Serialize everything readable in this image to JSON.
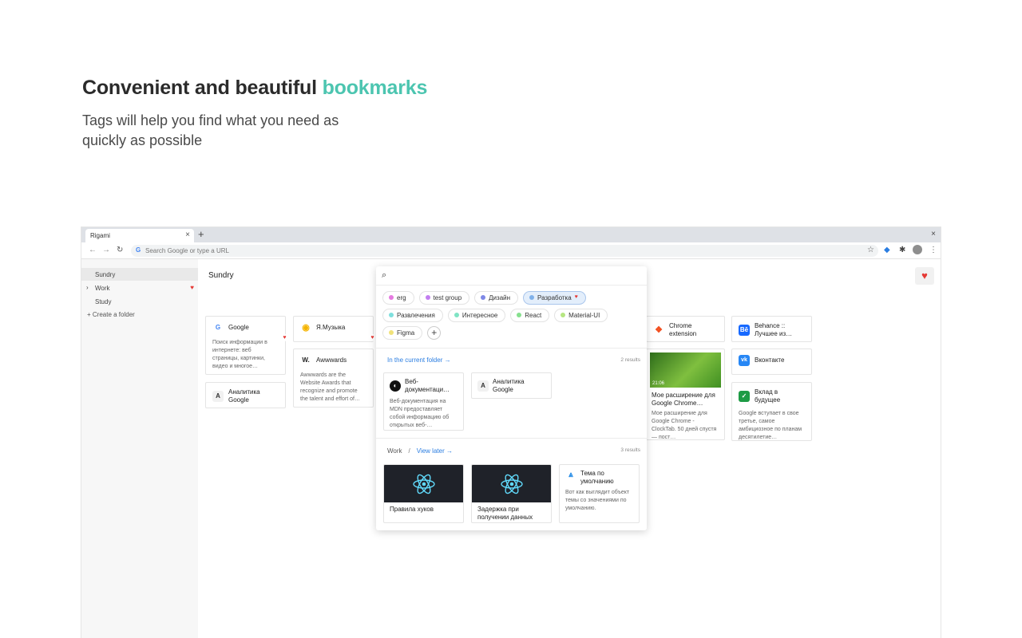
{
  "hero": {
    "title_main": "Convenient and beautiful ",
    "title_accent": "bookmarks",
    "subtitle": "Tags will help you find what you need as quickly as possible",
    "accent_color": "#4cc5b0"
  },
  "browser": {
    "tab_title": "Rigami",
    "tab_close": "×",
    "new_tab": "+",
    "window_close": "×",
    "address_placeholder": "Search Google or type a URL",
    "google_icon": "G"
  },
  "sidebar": {
    "items": [
      {
        "label": "Sundry",
        "active": true
      },
      {
        "label": "Work",
        "favorite": true
      },
      {
        "label": "Study"
      }
    ],
    "create_label": "+ Create a folder"
  },
  "main": {
    "folder_title": "Sundry",
    "cards": [
      {
        "title": "Google",
        "icon": "G",
        "desc": "Поиск информации в интернете: веб страницы, картинки, видео и многое…"
      },
      {
        "title": "Аналитика Google",
        "icon": "A"
      },
      {
        "title": "Я.Музыка",
        "icon": "music-icon"
      },
      {
        "title": "Awwwards",
        "icon": "W.",
        "desc": "Awwwards are the Website Awards that recognize and promote the talent and effort of…"
      },
      {
        "title": "Chrome extension",
        "icon": "figma-icon"
      },
      {
        "title": "Мое расширение для Google Chrome…",
        "thumb_time": "21:06",
        "desc": "Мое расширение для Google Chrome - ClockTab. 50 дней спустя — пост…"
      },
      {
        "title": "Behance :: Лучшее из…",
        "icon": "Bē"
      },
      {
        "title": "Вконтакте",
        "icon": "vk-icon"
      },
      {
        "title": "Вклад в будущее",
        "icon": "sber-icon",
        "desc": "Google вступает в свое третье, самое амбициозное по планам десятилетие…"
      }
    ]
  },
  "search": {
    "tags": [
      {
        "label": "erg",
        "color": "#e57ae0"
      },
      {
        "label": "test group",
        "color": "#c27ef0"
      },
      {
        "label": "Дизайн",
        "color": "#7e88e6"
      },
      {
        "label": "Разработка",
        "color": "#7fb1ea",
        "selected": true,
        "heart": "♥"
      },
      {
        "label": "Развлечения",
        "color": "#7fe0de"
      },
      {
        "label": "Интересное",
        "color": "#7fe4c4"
      },
      {
        "label": "React",
        "color": "#86e08e"
      },
      {
        "label": "Material-UI",
        "color": "#b6e682"
      },
      {
        "label": "Figma",
        "color": "#f1e27a"
      }
    ],
    "add_tag": "+",
    "current_folder": {
      "heading": "In the current folder",
      "count": "2 results",
      "cards": [
        {
          "title": "Веб-документаци…",
          "desc": "Веб-документация на MDN предоставляет собой информацию об открытых веб-…"
        },
        {
          "title": "Аналитика Google",
          "icon": "A"
        }
      ]
    },
    "other_folder": {
      "folder": "Work",
      "separator": "/",
      "subfolder": "View later",
      "count": "3 results",
      "cards": [
        {
          "title": "Правила хуков"
        },
        {
          "title": "Задержка при получении данных"
        },
        {
          "title": "Тема по умолчанию",
          "desc": "Вот как выглядит объект темы со значениями по умолчанию."
        }
      ]
    }
  }
}
